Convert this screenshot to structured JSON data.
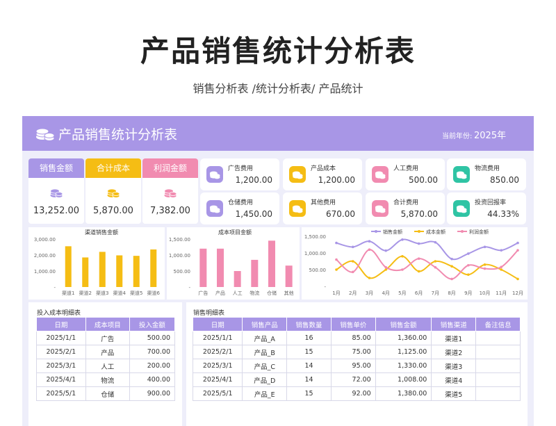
{
  "page": {
    "title": "产品销售统计分析表",
    "subtitle": "销售分析表 /统计分析表/ 产品统计"
  },
  "banner": {
    "title": "产品销售统计分析表",
    "year_label": "当前年份:",
    "year_value": "2025年",
    "icon": "coins-icon"
  },
  "colors": {
    "purple": "#a896e6",
    "yellow": "#f5bd14",
    "pink": "#f18bb0",
    "teal": "#2fc4a4",
    "background": "#eeeefa"
  },
  "kpis": [
    {
      "label": "销售金额",
      "value": "13,252.00",
      "color": "#a896e6",
      "icon": "coins-icon"
    },
    {
      "label": "合计成本",
      "value": "5,870.00",
      "color": "#f5bd14",
      "icon": "coins-icon"
    },
    {
      "label": "利润金额",
      "value": "7,382.00",
      "color": "#f18bb0",
      "icon": "coins-icon"
    }
  ],
  "cards": [
    {
      "label": "广告费用",
      "value": "1,200.00",
      "color": "#a896e6",
      "icon": "coins-icon"
    },
    {
      "label": "产品成本",
      "value": "1,200.00",
      "color": "#f5bd14",
      "icon": "coins-icon"
    },
    {
      "label": "人工费用",
      "value": "500.00",
      "color": "#f18bb0",
      "icon": "coins-icon"
    },
    {
      "label": "物流费用",
      "value": "850.00",
      "color": "#2fc4a4",
      "icon": "coins-icon"
    },
    {
      "label": "仓储费用",
      "value": "1,450.00",
      "color": "#a896e6",
      "icon": "coins-icon"
    },
    {
      "label": "其他费用",
      "value": "670.00",
      "color": "#f5bd14",
      "icon": "coins-icon"
    },
    {
      "label": "合计费用",
      "value": "5,870.00",
      "color": "#f18bb0",
      "icon": "coins-icon"
    },
    {
      "label": "投资回报率",
      "value": "44.33%",
      "color": "#2fc4a4",
      "icon": "coins-icon"
    }
  ],
  "chart_data": [
    {
      "type": "bar",
      "title": "渠道销售金额",
      "categories": [
        "渠道1",
        "渠道2",
        "渠道3",
        "渠道4",
        "渠道5",
        "渠道6"
      ],
      "values": [
        2550,
        1850,
        2200,
        1980,
        1950,
        2350
      ],
      "yticks": [
        "3,000.00",
        "2,000.00",
        "1,000.00",
        "-"
      ],
      "ylim": [
        0,
        3000
      ],
      "color": "#f5bd14",
      "grid": false
    },
    {
      "type": "bar",
      "title": "成本项目金额",
      "categories": [
        "广告",
        "产品",
        "人工",
        "物流",
        "仓储",
        "其他"
      ],
      "values": [
        1200,
        1200,
        500,
        850,
        1450,
        670
      ],
      "yticks": [
        "1,500.00",
        "1,000.00",
        "500.00",
        "-"
      ],
      "ylim": [
        0,
        1500
      ],
      "color": "#f18bb0",
      "grid": false
    },
    {
      "type": "line",
      "categories": [
        "1月",
        "2月",
        "3月",
        "4月",
        "5月",
        "6月",
        "7月",
        "8月",
        "9月",
        "10月",
        "11月",
        "12月"
      ],
      "yticks": [
        "1,500.00",
        "1,000.00",
        "500.00",
        "-"
      ],
      "ylim": [
        0,
        1500
      ],
      "legend_position": "top",
      "grid": false,
      "series": [
        {
          "name": "销售金额",
          "color": "#a896e6",
          "values": [
            1300,
            1180,
            1350,
            1070,
            1400,
            1280,
            1320,
            820,
            980,
            1180,
            1080,
            1300
          ]
        },
        {
          "name": "成本金额",
          "color": "#f5bd14",
          "values": [
            500,
            750,
            250,
            500,
            900,
            450,
            750,
            600,
            350,
            650,
            500,
            220
          ]
        },
        {
          "name": "利润金额",
          "color": "#f18bb0",
          "values": [
            800,
            430,
            1100,
            570,
            500,
            830,
            570,
            220,
            630,
            530,
            580,
            1080
          ]
        }
      ]
    }
  ],
  "cost_table": {
    "title": "投入成本明细表",
    "headers": [
      "日期",
      "成本项目",
      "投入金额"
    ],
    "rows": [
      [
        "2025/1/1",
        "广告",
        "500.00"
      ],
      [
        "2025/2/1",
        "产品",
        "700.00"
      ],
      [
        "2025/3/1",
        "人工",
        "200.00"
      ],
      [
        "2025/4/1",
        "物流",
        "400.00"
      ],
      [
        "2025/5/1",
        "仓储",
        "900.00"
      ]
    ]
  },
  "sales_table": {
    "title": "销售明细表",
    "headers": [
      "日期",
      "销售产品",
      "销售数量",
      "销售单价",
      "销售金额",
      "销售渠道",
      "备注信息"
    ],
    "rows": [
      [
        "2025/1/1",
        "产品_A",
        "16",
        "85.00",
        "1,360.00",
        "渠道1",
        ""
      ],
      [
        "2025/2/1",
        "产品_B",
        "15",
        "75.00",
        "1,125.00",
        "渠道2",
        ""
      ],
      [
        "2025/3/1",
        "产品_C",
        "14",
        "95.00",
        "1,330.00",
        "渠道3",
        ""
      ],
      [
        "2025/4/1",
        "产品_D",
        "14",
        "72.00",
        "1,008.00",
        "渠道4",
        ""
      ],
      [
        "2025/5/1",
        "产品_E",
        "15",
        "92.00",
        "1,380.00",
        "渠道5",
        ""
      ]
    ]
  }
}
